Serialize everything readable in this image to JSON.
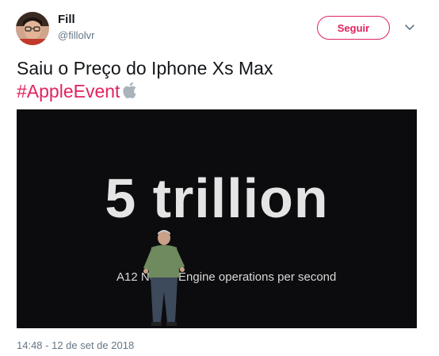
{
  "author": {
    "name": "Fill",
    "handle": "@fillolvr"
  },
  "follow_button": {
    "label": "Seguir"
  },
  "menu": {
    "icon": "chevron-down-icon"
  },
  "tweet": {
    "text": "Saiu o Preço do Iphone Xs Max",
    "hashtag": "#AppleEvent",
    "hashflag_icon": "apple-logo-icon"
  },
  "media": {
    "headline": "5 trillion",
    "caption_left": "A12 Ne",
    "caption_right": "Engine operations per second"
  },
  "timestamp": "14:48 - 12 de set de 2018",
  "colors": {
    "accent": "#e0245e",
    "text": "#14171a",
    "secondary": "#657786"
  }
}
